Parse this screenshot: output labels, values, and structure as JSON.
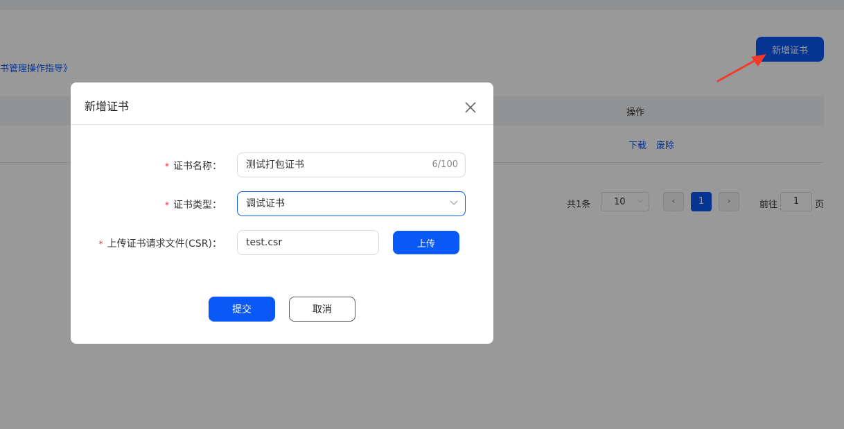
{
  "page": {
    "guide_link": "书管理操作指导》",
    "add_cert_button": "新增证书",
    "table": {
      "op_column": "操作",
      "row_actions": [
        "下载",
        "废除"
      ]
    },
    "pagination": {
      "total": "共1条",
      "page_size": "10",
      "prev": "‹",
      "current_page": "1",
      "next": "›",
      "goto_label": "前往",
      "goto_value": "1",
      "goto_suffix": "页"
    }
  },
  "dialog": {
    "title": "新增证书",
    "required_mark": "*",
    "fields": {
      "name": {
        "label": "证书名称：",
        "value": "测试打包证书",
        "counter": "6/100"
      },
      "type": {
        "label": "证书类型：",
        "value": "调试证书"
      },
      "csr": {
        "label": "上传证书请求文件(CSR)：",
        "value": "test.csr",
        "upload_button": "上传"
      }
    },
    "submit_button": "提交",
    "cancel_button": "取消"
  },
  "colors": {
    "primary": "#0a59f7",
    "required": "#f5222d",
    "annotation_arrow": "#f23a2a",
    "overlay": "rgba(0,0,0,0.4)"
  },
  "icons": {
    "close": "close-icon",
    "select_arrow": "chevron-down-icon",
    "annotation": "arrow-annotation-icon"
  }
}
